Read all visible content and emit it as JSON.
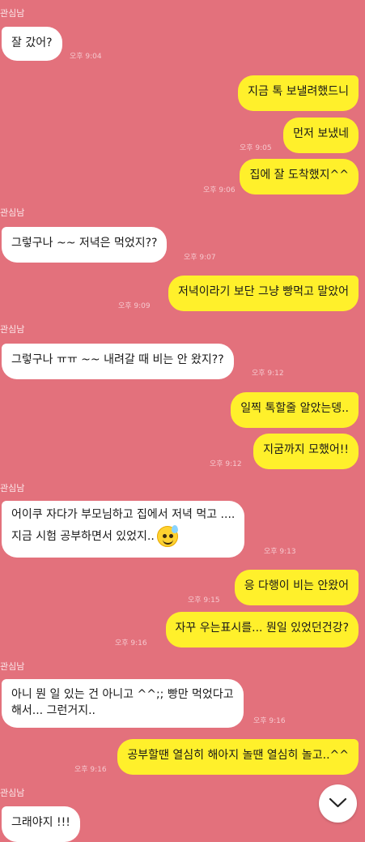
{
  "chat": {
    "senders": [
      "관심남",
      "관심남",
      "관심남",
      "관심남",
      "관심남"
    ],
    "messages": [
      {
        "text": "잘 갔어?",
        "time": "오후 9:04"
      },
      {
        "text": "지금 톡 보낼려했드니"
      },
      {
        "text": "먼저 보냈네",
        "time": "오후 9:05"
      },
      {
        "text": "집에 잘 도착했지^^",
        "time": "오후 9:06"
      },
      {
        "text": "그렇구나 ~~  저녁은 먹었지??",
        "time": "오후 9:07"
      },
      {
        "text": "저녁이라기 보단 그냥 빵먹고 말았어",
        "time": "오후 9:09"
      },
      {
        "text": "그렇구나 ㅠㅠ ~~ 내려갈 때 비는 안 왔지??",
        "time": "오후 9:12"
      },
      {
        "text": "일찍 톡할줄 알았는뎅.."
      },
      {
        "text": "지굼까지 모했어!!",
        "time": "오후 9:12"
      },
      {
        "line1": "어이쿠 자다가 부모님하고 집에서 저녁 먹고 ....",
        "line2": "지금 시험 공부하면서 있었지..",
        "time": "오후 9:13"
      },
      {
        "text": "응 다행이 비는 안왔어",
        "time": "오후 9:15"
      },
      {
        "text": "자꾸 우는표시를... 뭔일 있었던건강?",
        "time": "오후 9:16"
      },
      {
        "line1": "아니 뭔 일 있는 건 아니고 ^^;; 빵만 먹었다고",
        "line2": "해서... 그런거지..",
        "time": "오후 9:16"
      },
      {
        "text": "공부할땐 열심히 해아지 놀땐 열심히 놀고..^^",
        "time": "오후 9:16"
      },
      {
        "text": "그래야지 !!!"
      }
    ]
  },
  "icons": {
    "emoji": "sweat-smile-emoji",
    "scroll": "chevron-down-icon"
  },
  "colors": {
    "background": "#e3717c",
    "incoming": "#ffffff",
    "outgoing": "#fff02b"
  }
}
